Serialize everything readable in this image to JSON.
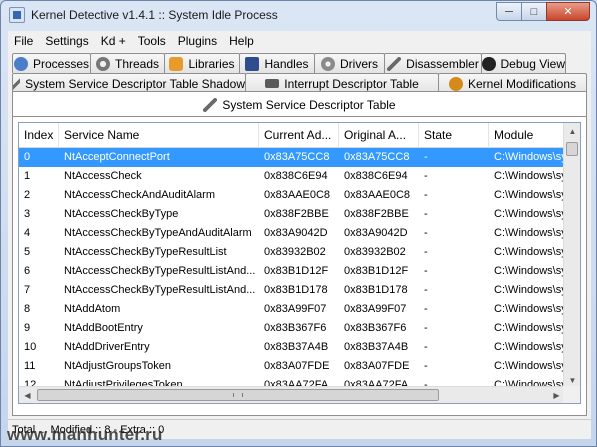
{
  "window": {
    "title": "Kernel Detective v1.4.1 :: System Idle Process"
  },
  "menu": [
    "File",
    "Settings",
    "Kd +",
    "Tools",
    "Plugins",
    "Help"
  ],
  "tabs_row1": [
    {
      "label": "Processes",
      "icon": "processes-icon"
    },
    {
      "label": "Threads",
      "icon": "threads-icon"
    },
    {
      "label": "Libraries",
      "icon": "libraries-icon"
    },
    {
      "label": "Handles",
      "icon": "handles-icon"
    },
    {
      "label": "Drivers",
      "icon": "drivers-icon"
    },
    {
      "label": "Disassembler",
      "icon": "disassembler-icon"
    },
    {
      "label": "Debug View",
      "icon": "debug-view-icon"
    }
  ],
  "tabs_row2": [
    {
      "label": "System Service Descriptor Table Shadow",
      "icon": "wrench-icon"
    },
    {
      "label": "Interrupt Descriptor Table",
      "icon": "chip-icon"
    },
    {
      "label": "Kernel Modifications",
      "icon": "warning-icon"
    }
  ],
  "active_tab": {
    "label": "System Service Descriptor Table",
    "icon": "wrench-icon"
  },
  "table": {
    "columns": [
      "Index",
      "Service Name",
      "Current Ad...",
      "Original A...",
      "State",
      "Module"
    ],
    "rows": [
      [
        "0",
        "NtAcceptConnectPort",
        "0x83A75CC8",
        "0x83A75CC8",
        "-",
        "C:\\Windows\\sys"
      ],
      [
        "1",
        "NtAccessCheck",
        "0x838C6E94",
        "0x838C6E94",
        "-",
        "C:\\Windows\\sys"
      ],
      [
        "2",
        "NtAccessCheckAndAuditAlarm",
        "0x83AAE0C8",
        "0x83AAE0C8",
        "-",
        "C:\\Windows\\sys"
      ],
      [
        "3",
        "NtAccessCheckByType",
        "0x838F2BBE",
        "0x838F2BBE",
        "-",
        "C:\\Windows\\sys"
      ],
      [
        "4",
        "NtAccessCheckByTypeAndAuditAlarm",
        "0x83A9042D",
        "0x83A9042D",
        "-",
        "C:\\Windows\\sys"
      ],
      [
        "5",
        "NtAccessCheckByTypeResultList",
        "0x83932B02",
        "0x83932B02",
        "-",
        "C:\\Windows\\sys"
      ],
      [
        "6",
        "NtAccessCheckByTypeResultListAnd...",
        "0x83B1D12F",
        "0x83B1D12F",
        "-",
        "C:\\Windows\\sys"
      ],
      [
        "7",
        "NtAccessCheckByTypeResultListAnd...",
        "0x83B1D178",
        "0x83B1D178",
        "-",
        "C:\\Windows\\sys"
      ],
      [
        "8",
        "NtAddAtom",
        "0x83A99F07",
        "0x83A99F07",
        "-",
        "C:\\Windows\\sys"
      ],
      [
        "9",
        "NtAddBootEntry",
        "0x83B367F6",
        "0x83B367F6",
        "-",
        "C:\\Windows\\sys"
      ],
      [
        "10",
        "NtAddDriverEntry",
        "0x83B37A4B",
        "0x83B37A4B",
        "-",
        "C:\\Windows\\sys"
      ],
      [
        "11",
        "NtAdjustGroupsToken",
        "0x83A07FDE",
        "0x83A07FDE",
        "-",
        "C:\\Windows\\sys"
      ],
      [
        "12",
        "NtAdjustPrivilegesToken",
        "0x83AA72FA",
        "0x83AA72FA",
        "-",
        "C:\\Windows\\sys"
      ]
    ],
    "selected_row": 0
  },
  "status": {
    "text": "Total ... Modified :: 8 - Extra :: 0"
  },
  "watermark": "www.manhunter.ru"
}
